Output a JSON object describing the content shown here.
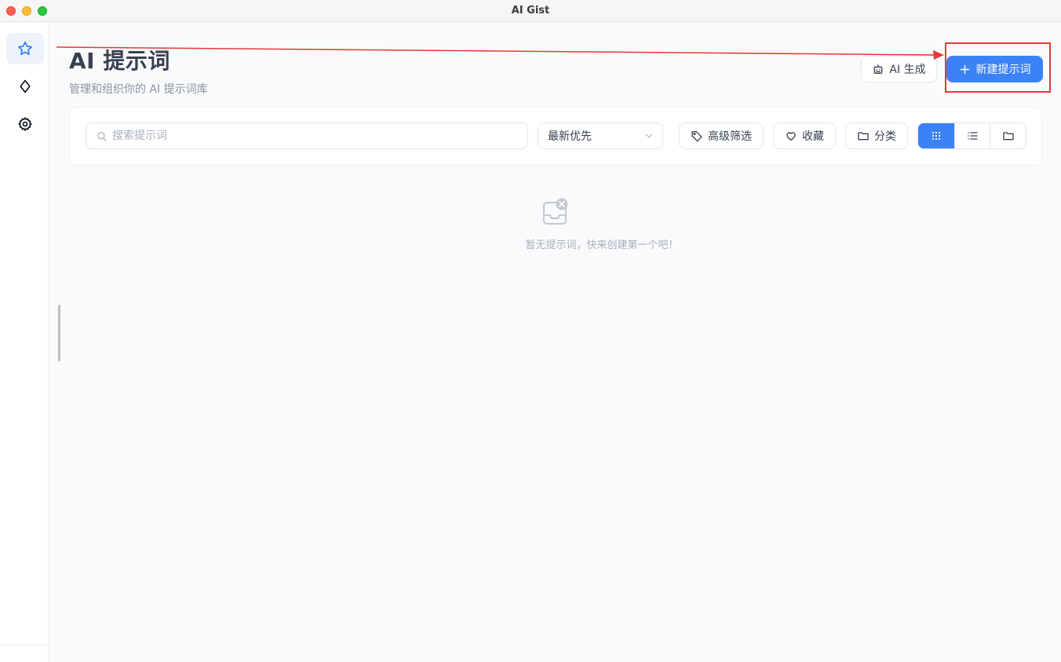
{
  "window": {
    "title": "AI Gist"
  },
  "sidebar": {
    "items": [
      {
        "icon": "star-icon",
        "active": true
      },
      {
        "icon": "diamond-icon",
        "active": false
      },
      {
        "icon": "gear-icon",
        "active": false
      }
    ]
  },
  "header": {
    "title": "AI 提示词",
    "subtitle": "管理和组织你的 AI 提示词库",
    "ai_generate_label": "AI 生成",
    "new_prompt_label": "新建提示词"
  },
  "toolbar": {
    "search_placeholder": "搜索提示词",
    "sort_selected": "最新优先",
    "advanced_filter_label": "高级筛选",
    "favorites_label": "收藏",
    "category_label": "分类",
    "view_modes": [
      "grid",
      "list",
      "folder"
    ],
    "active_view": "grid"
  },
  "empty_state": {
    "message": "暂无提示词，快来创建第一个吧！"
  },
  "colors": {
    "accent": "#3b82f6",
    "annotation": "#e53935"
  }
}
